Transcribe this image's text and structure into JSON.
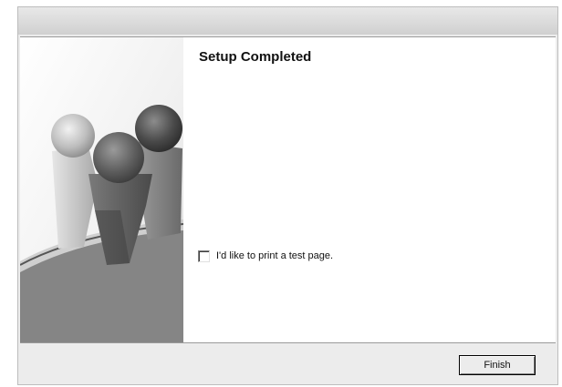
{
  "dialog": {
    "heading": "Setup Completed",
    "checkbox": {
      "label": "I'd like to print a test page.",
      "checked": false
    },
    "finish_label": "Finish"
  },
  "side_art": {
    "icon": "people-spheres-graphic"
  }
}
